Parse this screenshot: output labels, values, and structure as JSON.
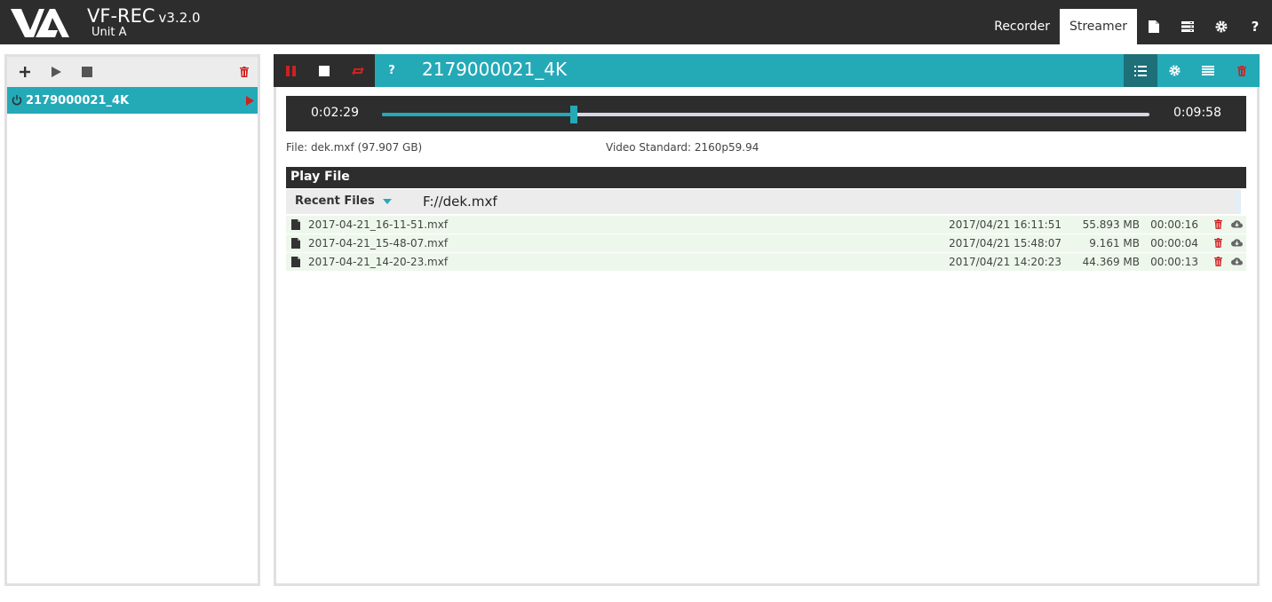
{
  "app": {
    "title": "VF-REC",
    "version": "v3.2.0",
    "unit": "Unit A"
  },
  "nav": {
    "tabs": [
      {
        "label": "Recorder"
      },
      {
        "label": "Streamer"
      }
    ],
    "icons": [
      "file-icon",
      "storage-icon",
      "settings-icon",
      "help-icon"
    ],
    "help_glyph": "?"
  },
  "channels": [
    {
      "name": "2179000021_4K"
    }
  ],
  "channel_header": {
    "title": "2179000021_4K",
    "help_glyph": "?"
  },
  "player": {
    "elapsed": "0:02:29",
    "total": "0:09:58",
    "progress": 0.25
  },
  "file_info": {
    "file": "File: dek.mxf (97.907 GB)",
    "standard": "Video Standard: 2160p59.94"
  },
  "play_file": {
    "title": "Play File",
    "recent_label": "Recent Files",
    "path": "F://dek.mxf"
  },
  "files": [
    {
      "name": "2017-04-21_16-11-51.mxf",
      "date": "2017/04/21 16:11:51",
      "size": "55.893 MB",
      "duration": "00:00:16"
    },
    {
      "name": "2017-04-21_15-48-07.mxf",
      "date": "2017/04/21 15:48:07",
      "size": "9.161 MB",
      "duration": "00:00:04"
    },
    {
      "name": "2017-04-21_14-20-23.mxf",
      "date": "2017/04/21 14:20:23",
      "size": "44.369 MB",
      "duration": "00:00:13"
    }
  ],
  "colors": {
    "accent": "#24a9b7",
    "dark": "#2d2d2d",
    "danger": "#cc2222"
  }
}
